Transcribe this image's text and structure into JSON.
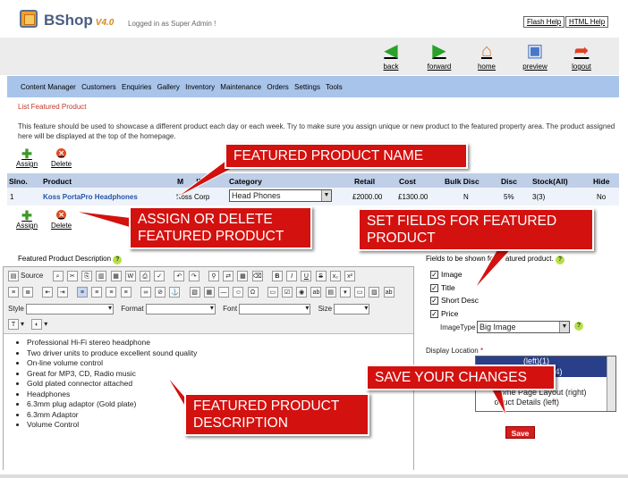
{
  "header": {
    "brand": "BShop",
    "version": "V4.0",
    "logged_in": "Logged in as Super Admin !",
    "flash_help": "Flash Help",
    "html_help": "HTML Help"
  },
  "toolbar": {
    "back": "back",
    "forward": "forward",
    "home": "home",
    "preview": "preview",
    "logout": "logout"
  },
  "menu": [
    "Content Manager",
    "Customers",
    "Enquiries",
    "Gallery",
    "Inventory",
    "Maintenance",
    "Orders",
    "Settings",
    "Tools"
  ],
  "breadcrumb": "List Featured Product",
  "intro": "This feature should be used to showcase a different product each day or each week. Try to make sure you assign unique or new product to the featured property area. The product assigned here will be displayed at the top of the homepage.",
  "actions": {
    "assign": "Assign",
    "delete": "Delete"
  },
  "table": {
    "headers": {
      "slno": "Slno.",
      "product": "Product",
      "mfd": "M      ID",
      "category": "Category",
      "retail": "Retail",
      "cost": "Cost",
      "bulk": "Bulk Disc",
      "disc": "Disc",
      "stock": "Stock(All)",
      "hide": "Hide"
    },
    "row": {
      "slno": "1",
      "product": "Koss PortaPro Headphones",
      "mfd": "Koss Corp",
      "category": "Head Phones",
      "retail": "£2000.00",
      "cost": "£1300.00",
      "bulk": "N",
      "disc": "5%",
      "stock": "3(3)",
      "hide": "No"
    }
  },
  "editor": {
    "label": "Featured Product Description",
    "source": "Source",
    "style": "Style",
    "format": "Format",
    "font": "Font",
    "size": "Size",
    "bullets": [
      "Professional Hi-Fi stereo headphone",
      "Two driver units to produce excellent sound quality",
      "On-line volume control",
      "Great for MP3, CD, Radio music",
      "Gold plated connector attached",
      "Headphones",
      "6.3mm plug adaptor (Gold plate)",
      "6.3mm Adaptor",
      "Volume Control"
    ]
  },
  "fields": {
    "label": "Fields to be shown fo      atured product.",
    "image": "Image",
    "title": "Title",
    "short_desc": "Short Desc",
    "price": "Price",
    "image_type_label": "ImageType",
    "image_type_value": "Big Image",
    "display_location_label": "Display Location",
    "display_options": [
      "                    (left)(1)",
      "                    (middle)(4)",
      "                   (left)",
      "       Home Page Layout (right)",
      "       oduct Details (left)"
    ],
    "save": "Save"
  },
  "callouts": {
    "name": "FEATURED PRODUCT  NAME",
    "assign_delete": "ASSIGN OR DELETE\nFEATURED PRODUCT",
    "set_fields": "SET FIELDS FOR FEATURED\nPRODUCT",
    "save_changes": "SAVE YOUR CHANGES",
    "description": "FEATURED PRODUCT\nDESCRIPTION"
  }
}
